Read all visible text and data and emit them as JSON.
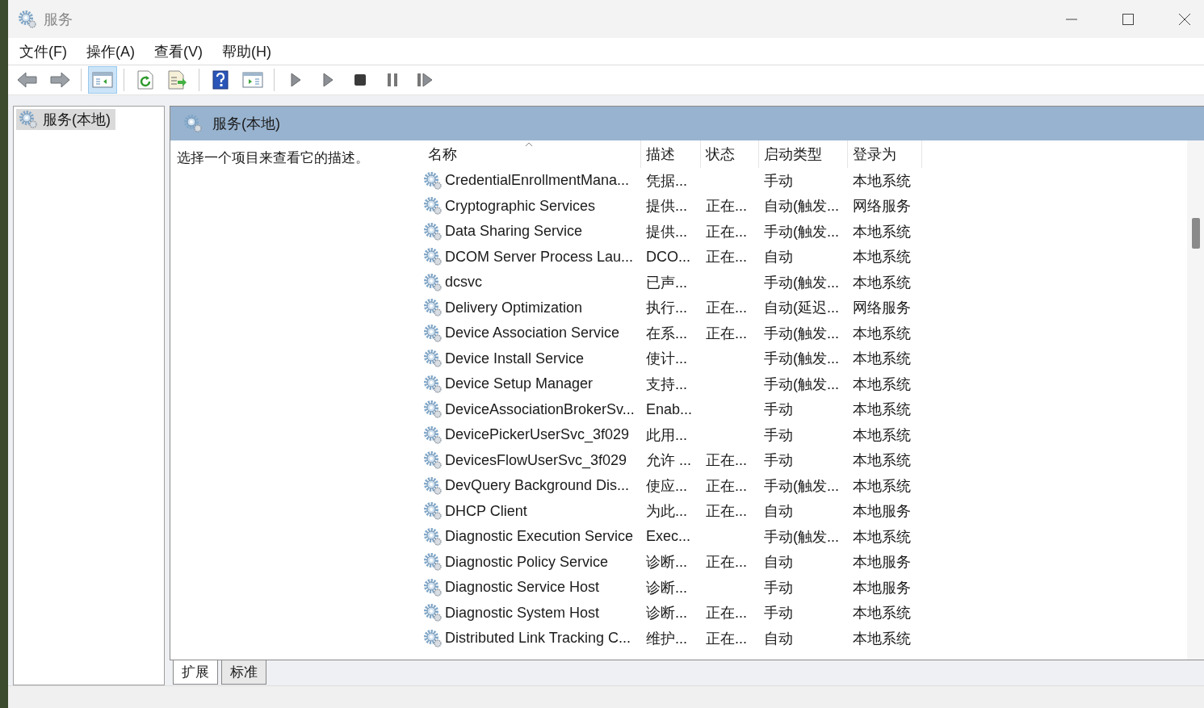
{
  "window": {
    "title": "服务"
  },
  "menu": [
    "文件(F)",
    "操作(A)",
    "查看(V)",
    "帮助(H)"
  ],
  "toolbar": [
    {
      "kind": "back"
    },
    {
      "kind": "forward"
    },
    {
      "kind": "sep"
    },
    {
      "kind": "console",
      "selected": true
    },
    {
      "kind": "sep"
    },
    {
      "kind": "refresh",
      "selected": false
    },
    {
      "kind": "export",
      "selected": false
    },
    {
      "kind": "sep"
    },
    {
      "kind": "help",
      "selected": false
    },
    {
      "kind": "pane",
      "selected": false
    },
    {
      "kind": "sep"
    },
    {
      "kind": "start",
      "selected": false
    },
    {
      "kind": "start2",
      "selected": false
    },
    {
      "kind": "stop",
      "selected": false
    },
    {
      "kind": "pause",
      "selected": false
    },
    {
      "kind": "resume",
      "selected": false
    }
  ],
  "tree": {
    "items": [
      {
        "label": "服务(本地)",
        "selected": true
      }
    ]
  },
  "panel": {
    "title": "服务(本地)",
    "description": "选择一个项目来查看它的描述。"
  },
  "table": {
    "columns": [
      "名称",
      "描述",
      "状态",
      "启动类型",
      "登录为"
    ],
    "rows": [
      [
        "CredentialEnrollmentMana...",
        "凭据...",
        "",
        "手动",
        "本地系统"
      ],
      [
        "Cryptographic Services",
        "提供...",
        "正在...",
        "自动(触发...",
        "网络服务"
      ],
      [
        "Data Sharing Service",
        "提供...",
        "正在...",
        "手动(触发...",
        "本地系统"
      ],
      [
        "DCOM Server Process Lau...",
        "DCO...",
        "正在...",
        "自动",
        "本地系统"
      ],
      [
        "dcsvc",
        "已声...",
        "",
        "手动(触发...",
        "本地系统"
      ],
      [
        "Delivery Optimization",
        "执行...",
        "正在...",
        "自动(延迟...",
        "网络服务"
      ],
      [
        "Device Association Service",
        "在系...",
        "正在...",
        "手动(触发...",
        "本地系统"
      ],
      [
        "Device Install Service",
        "使计...",
        "",
        "手动(触发...",
        "本地系统"
      ],
      [
        "Device Setup Manager",
        "支持...",
        "",
        "手动(触发...",
        "本地系统"
      ],
      [
        "DeviceAssociationBrokerSv...",
        "Enab...",
        "",
        "手动",
        "本地系统"
      ],
      [
        "DevicePickerUserSvc_3f029",
        "此用...",
        "",
        "手动",
        "本地系统"
      ],
      [
        "DevicesFlowUserSvc_3f029",
        "允许 ...",
        "正在...",
        "手动",
        "本地系统"
      ],
      [
        "DevQuery Background Dis...",
        "使应...",
        "正在...",
        "手动(触发...",
        "本地系统"
      ],
      [
        "DHCP Client",
        "为此...",
        "正在...",
        "自动",
        "本地服务"
      ],
      [
        "Diagnostic Execution Service",
        "Exec...",
        "",
        "手动(触发...",
        "本地系统"
      ],
      [
        "Diagnostic Policy Service",
        "诊断...",
        "正在...",
        "自动",
        "本地服务"
      ],
      [
        "Diagnostic Service Host",
        "诊断...",
        "",
        "手动",
        "本地服务"
      ],
      [
        "Diagnostic System Host",
        "诊断...",
        "正在...",
        "手动",
        "本地系统"
      ],
      [
        "Distributed Link Tracking C...",
        "维护...",
        "正在...",
        "自动",
        "本地系统"
      ]
    ]
  },
  "tabs": [
    {
      "label": "扩展",
      "selected": true
    },
    {
      "label": "标准",
      "selected": false
    }
  ]
}
